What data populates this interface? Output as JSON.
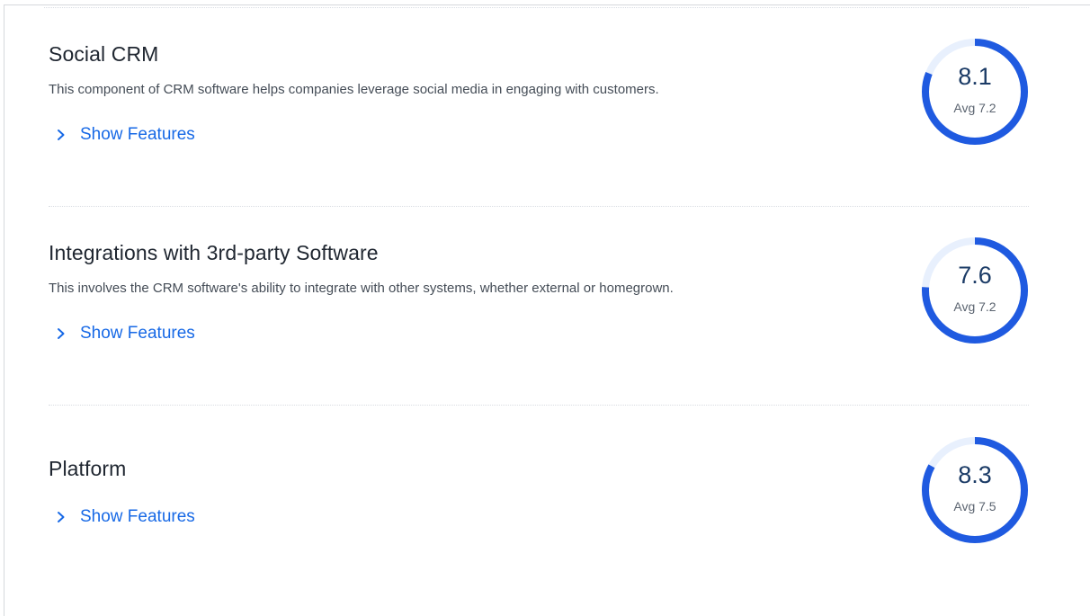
{
  "sections": [
    {
      "title": "Social CRM",
      "description": "This component of CRM software helps companies leverage social media in engaging with customers.",
      "show_features_label": "Show Features",
      "score": "8.1",
      "score_fraction": 0.81,
      "avg_label": "Avg 7.2"
    },
    {
      "title": "Integrations with 3rd-party Software",
      "description": "This involves the CRM software's ability to integrate with other systems, whether external or homegrown.",
      "show_features_label": "Show Features",
      "score": "7.6",
      "score_fraction": 0.76,
      "avg_label": "Avg 7.2"
    },
    {
      "title": "Platform",
      "description": "",
      "show_features_label": "Show Features",
      "score": "8.3",
      "score_fraction": 0.83,
      "avg_label": "Avg 7.5"
    }
  ],
  "colors": {
    "ring_fill": "#1f5ae0",
    "ring_track": "#e8f0fd",
    "link": "#1769e6",
    "title": "#1f2630",
    "score": "#1b3b66"
  },
  "icons": {
    "expand": "chevron-right-icon"
  }
}
